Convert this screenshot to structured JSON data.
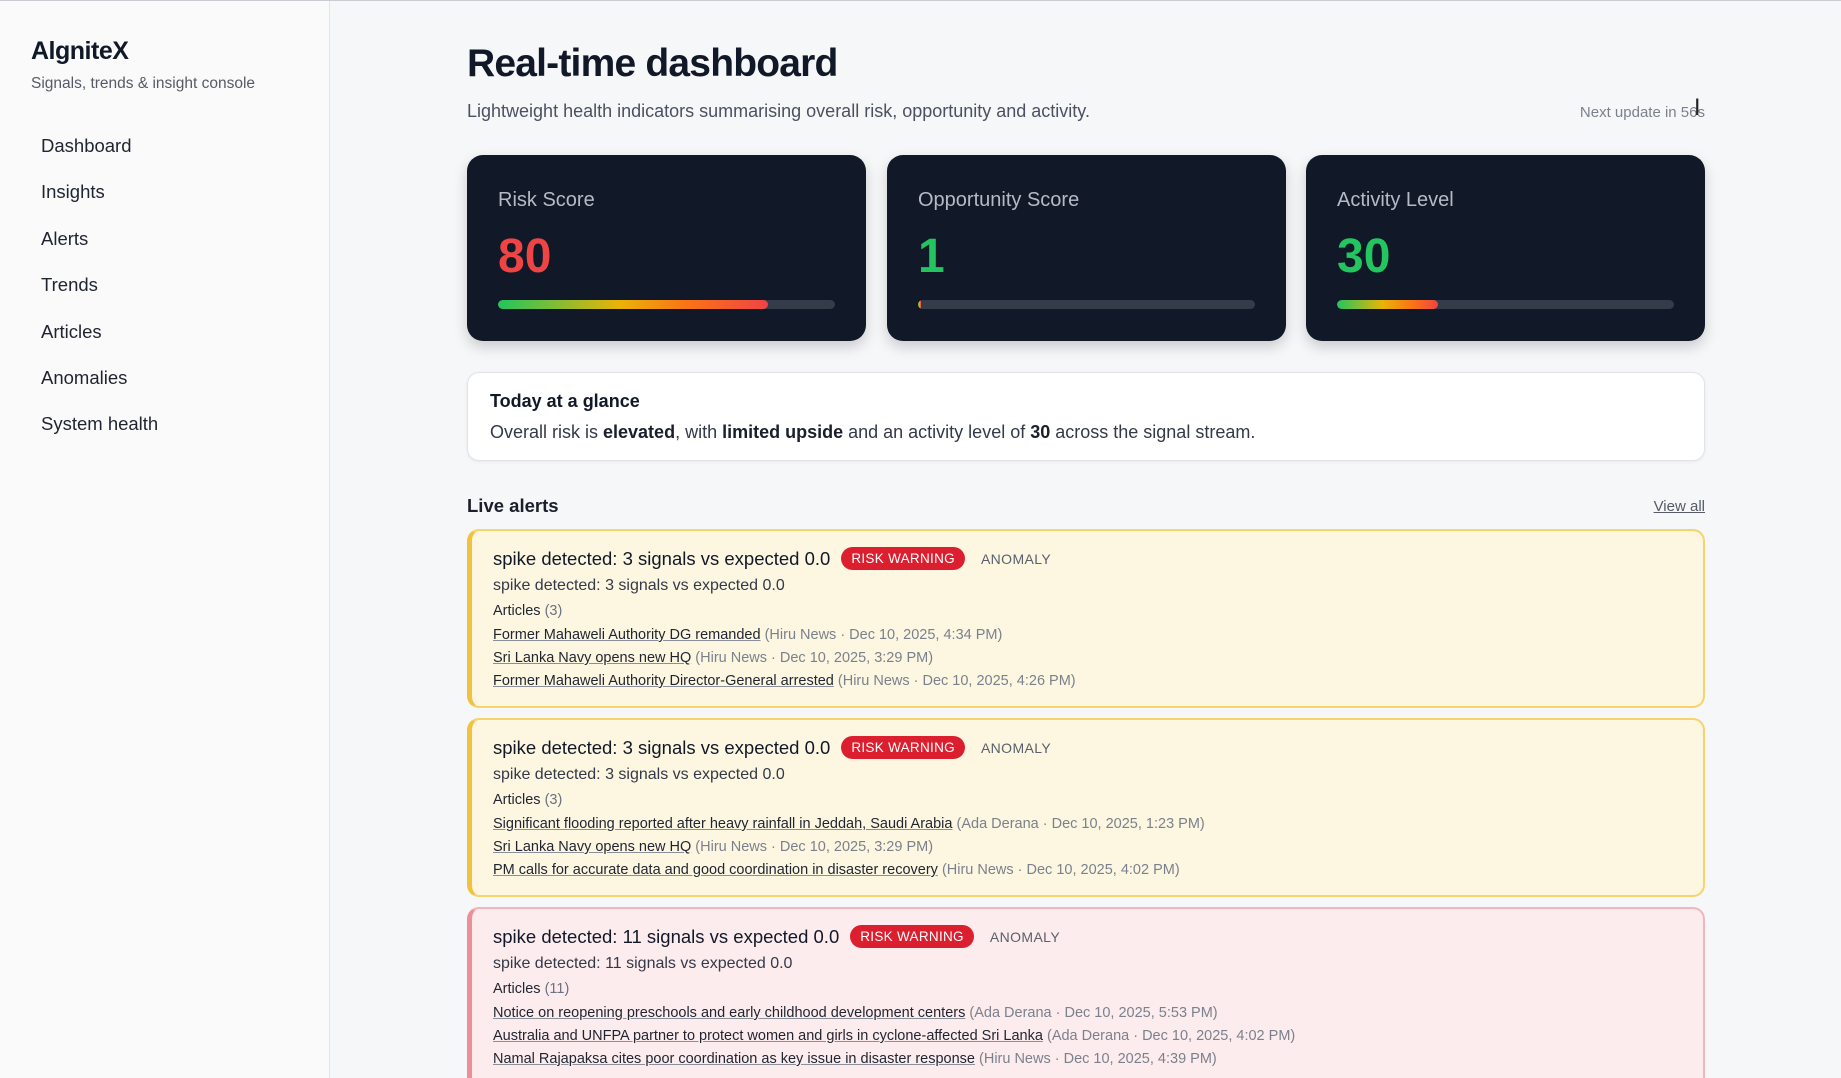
{
  "app": {
    "name": "AlgniteX",
    "tagline": "Signals, trends & insight console"
  },
  "nav": [
    {
      "label": "Dashboard"
    },
    {
      "label": "Insights"
    },
    {
      "label": "Alerts"
    },
    {
      "label": "Trends"
    },
    {
      "label": "Articles"
    },
    {
      "label": "Anomalies"
    },
    {
      "label": "System health"
    }
  ],
  "header": {
    "title": "Real-time dashboard",
    "subtitle": "Lightweight health indicators summarising overall risk, opportunity and activity.",
    "next_update": "Next update in 56s"
  },
  "metrics": [
    {
      "label": "Risk Score",
      "value": "80",
      "color": "#ef4444",
      "progress": 0.8
    },
    {
      "label": "Opportunity Score",
      "value": "1",
      "color": "#22c55e",
      "progress": 0.01
    },
    {
      "label": "Activity Level",
      "value": "30",
      "color": "#22c55e",
      "progress": 0.3
    }
  ],
  "glance": {
    "title": "Today at a glance",
    "p1": "Overall risk is ",
    "b1": "elevated",
    "p2": ", with ",
    "b2": "limited upside",
    "p3": " and an activity level of ",
    "b3": "30",
    "p4": " across the signal stream."
  },
  "live_alerts": {
    "title": "Live alerts",
    "view_all": "View all",
    "items": [
      {
        "title": "spike detected: 3 signals vs expected 0.0",
        "badge": "RISK WARNING",
        "tag": "ANOMALY",
        "description": "spike detected: 3 signals vs expected 0.0",
        "articles_label": "Articles",
        "articles_count": "(3)",
        "articles": [
          {
            "title": "Former Mahaweli Authority DG remanded",
            "meta": "(Hiru News · Dec 10, 2025, 4:34 PM)"
          },
          {
            "title": "Sri Lanka Navy opens new HQ",
            "meta": "(Hiru News · Dec 10, 2025, 3:29 PM)"
          },
          {
            "title": "Former Mahaweli Authority Director-General arrested",
            "meta": "(Hiru News · Dec 10, 2025, 4:26 PM)"
          }
        ]
      },
      {
        "title": "spike detected: 3 signals vs expected 0.0",
        "badge": "RISK WARNING",
        "tag": "ANOMALY",
        "description": "spike detected: 3 signals vs expected 0.0",
        "articles_label": "Articles",
        "articles_count": "(3)",
        "articles": [
          {
            "title": "Significant flooding reported after heavy rainfall in Jeddah, Saudi Arabia",
            "meta": "(Ada Derana · Dec 10, 2025, 1:23 PM)"
          },
          {
            "title": "Sri Lanka Navy opens new HQ",
            "meta": "(Hiru News · Dec 10, 2025, 3:29 PM)"
          },
          {
            "title": "PM calls for accurate data and good coordination in disaster recovery",
            "meta": "(Hiru News · Dec 10, 2025, 4:02 PM)"
          }
        ]
      },
      {
        "title": "spike detected: 11 signals vs expected 0.0",
        "badge": "RISK WARNING",
        "tag": "ANOMALY",
        "description": "spike detected: 11 signals vs expected 0.0",
        "articles_label": "Articles",
        "articles_count": "(11)",
        "articles": [
          {
            "title": "Notice on reopening preschools and early childhood development centers",
            "meta": "(Ada Derana · Dec 10, 2025, 5:53 PM)"
          },
          {
            "title": "Australia and UNFPA partner to protect women and girls in cyclone-affected Sri Lanka",
            "meta": "(Ada Derana · Dec 10, 2025, 4:02 PM)"
          },
          {
            "title": "Namal Rajapaksa cites poor coordination as key issue in disaster response",
            "meta": "(Hiru News · Dec 10, 2025, 4:39 PM)"
          }
        ]
      }
    ]
  },
  "colors": {
    "background": "#f6f7f9",
    "card": "#111827",
    "risk_red": "#ef4444",
    "ok_green": "#22c55e",
    "warn_bg": "#fdf7e2",
    "danger_bg": "#fdeced"
  }
}
